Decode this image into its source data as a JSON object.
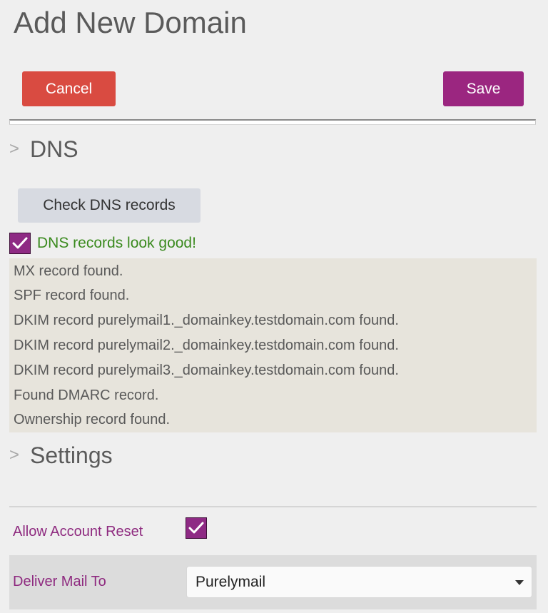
{
  "page": {
    "title": "Add New Domain"
  },
  "actions": {
    "cancel_label": "Cancel",
    "save_label": "Save"
  },
  "dns": {
    "section_title": "DNS",
    "chevron": ">",
    "check_button_label": "Check DNS records",
    "status_checked": true,
    "status_text": "DNS records look good!",
    "results": [
      "MX record found.",
      "SPF record found.",
      "DKIM record purelymail1._domainkey.testdomain.com found.",
      "DKIM record purelymail2._domainkey.testdomain.com found.",
      "DKIM record purelymail3._domainkey.testdomain.com found.",
      "Found DMARC record.",
      "Ownership record found."
    ]
  },
  "settings": {
    "section_title": "Settings",
    "chevron": ">",
    "allow_account_reset": {
      "label": "Allow Account Reset",
      "checked": true
    },
    "deliver_mail_to": {
      "label": "Deliver Mail To",
      "value": "Purelymail"
    }
  },
  "colors": {
    "cancel": "#d94b41",
    "save": "#9b2680",
    "checkbox": "#8e2a84",
    "success_text": "#3a8a1e",
    "setting_label": "#8e2a7f"
  }
}
